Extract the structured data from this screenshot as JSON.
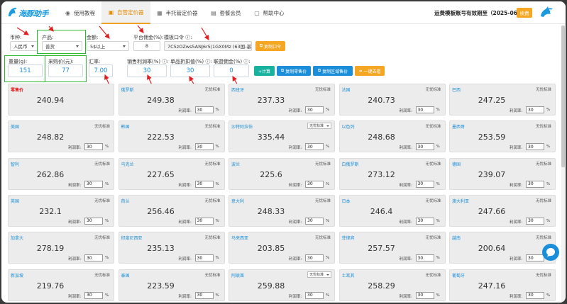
{
  "app": {
    "logo_text": "海豚助手",
    "expiry_text": "运费模板账号有效期至（2025-06-07）",
    "renew_label": "续费"
  },
  "nav": [
    {
      "label": "使用教程",
      "icon": "user-circle-icon"
    },
    {
      "label": "自营定价器",
      "icon": "price-tag-icon",
      "active": true
    },
    {
      "label": "半托管定价器",
      "icon": "calculator-icon"
    },
    {
      "label": "套餐会员",
      "icon": "package-icon"
    },
    {
      "label": "帮助中心",
      "icon": "help-icon"
    }
  ],
  "form": {
    "currency_label": "币种:",
    "currency_value": "人民币",
    "product_label": "产品:",
    "product_value": "普货",
    "amount_label": "金额:",
    "amount_value": "5$以上",
    "platform_commission_label": "平台佣金(%):",
    "platform_commission_value": "8",
    "template_code_label": "模板口令 ⓘ:",
    "template_code_value": "7C5zOZws5ANJ6r5|1GX0Mz (63国-基本号",
    "copy_code_button": "复制口令",
    "weight_label": "重量(g):",
    "weight_value": "151",
    "purchase_price_label": "采购价(元):",
    "purchase_price_value": "77",
    "exchange_rate_label": "汇率:",
    "exchange_rate_value": "7.00",
    "sales_margin_label": "销售利润率(%) ⓘ:",
    "sales_margin_value": "30",
    "discount_label": "单品折扣值(%) ⓘ:",
    "discount_value": "30",
    "affiliate_label": "联盟佣金(%) ⓘ:",
    "affiliate_value": "0",
    "calc_button": "+计算",
    "copy_retail_button": "复制零售价",
    "copy_region_button": "复制区域售价",
    "one_click_button": "一键去看"
  },
  "card_common": {
    "tag_text": "无忧标准",
    "margin_label": "利润率:",
    "pct": "%"
  },
  "cards": [
    {
      "name": "零售价",
      "price": "240.94",
      "red": true,
      "margin": ""
    },
    {
      "name": "俄罗斯",
      "price": "249.38",
      "margin": "30"
    },
    {
      "name": "西班牙",
      "price": "237.33",
      "margin": "30"
    },
    {
      "name": "法国",
      "price": "240.73",
      "margin": "30"
    },
    {
      "name": "巴西",
      "price": "247.25",
      "margin": "30"
    },
    {
      "name": "美国",
      "price": "248.82",
      "margin": "30"
    },
    {
      "name": "韩国",
      "price": "222.53",
      "margin": "30"
    },
    {
      "name": "沙特阿拉伯",
      "price": "335.44",
      "margin": "30",
      "select": true
    },
    {
      "name": "以色列",
      "price": "248.68",
      "margin": "30"
    },
    {
      "name": "墨西哥",
      "price": "253.59",
      "margin": "30"
    },
    {
      "name": "智利",
      "price": "262.86",
      "margin": "30"
    },
    {
      "name": "乌克兰",
      "price": "227.65",
      "margin": "30"
    },
    {
      "name": "波兰",
      "price": "225.6",
      "margin": "30"
    },
    {
      "name": "白俄罗斯",
      "price": "273.12",
      "margin": "30"
    },
    {
      "name": "德国",
      "price": "239.07",
      "margin": "30"
    },
    {
      "name": "英国",
      "price": "232.1",
      "margin": "30"
    },
    {
      "name": "荷兰",
      "price": "256.46",
      "margin": "30"
    },
    {
      "name": "意大利",
      "price": "248.33",
      "margin": "30"
    },
    {
      "name": "日本",
      "price": "246.4",
      "margin": "30"
    },
    {
      "name": "澳大利亚",
      "price": "247.66",
      "margin": "30"
    },
    {
      "name": "加拿大",
      "price": "278.19",
      "margin": "30"
    },
    {
      "name": "印度尼西亚",
      "price": "235.13",
      "margin": "30"
    },
    {
      "name": "马来西亚",
      "price": "203.85",
      "margin": "30"
    },
    {
      "name": "菲律宾",
      "price": "257.57",
      "margin": "30"
    },
    {
      "name": "越南",
      "price": "200.64",
      "margin": "30"
    },
    {
      "name": "新加坡",
      "price": "219.76",
      "margin": "30"
    },
    {
      "name": "泰国",
      "price": "223.59",
      "margin": "30"
    },
    {
      "name": "阿联酋",
      "price": "259.88",
      "margin": "30",
      "select": true
    },
    {
      "name": "土耳其",
      "price": "258.29",
      "margin": "30"
    },
    {
      "name": "葡萄牙",
      "price": "247.16",
      "margin": "30"
    }
  ],
  "colors": {
    "accent_orange": "#f5a623",
    "link_blue": "#1a8ed8",
    "highlight_green": "#2eb82e",
    "annotation_red": "#e02020"
  }
}
